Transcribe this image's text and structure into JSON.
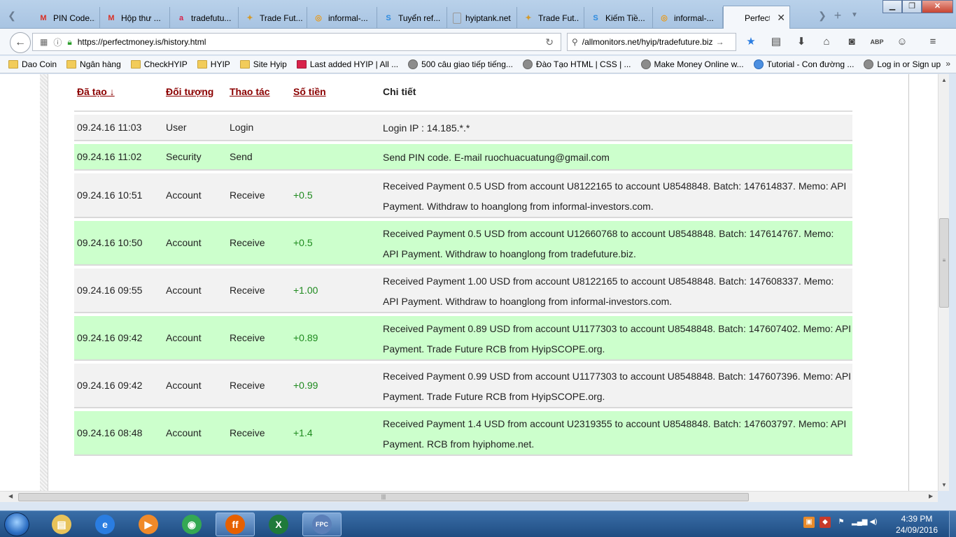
{
  "browser": {
    "tabs": [
      {
        "title": "PIN Code...",
        "icon": "gmail-icon",
        "glyph": "M",
        "color": "#d93025"
      },
      {
        "title": "Hộp thư ...",
        "icon": "gmail-icon",
        "glyph": "M",
        "color": "#d93025"
      },
      {
        "title": "tradefutu...",
        "icon": "a-logo-icon",
        "glyph": "a",
        "color": "#d8224a"
      },
      {
        "title": "Trade Fut...",
        "icon": "trade-future-icon",
        "glyph": "✦",
        "color": "#d49a2a"
      },
      {
        "title": "informal-...",
        "icon": "informal-investors-icon",
        "glyph": "◎",
        "color": "#e89a1a"
      },
      {
        "title": "Tuyển ref...",
        "icon": "skype-icon",
        "glyph": "S",
        "color": "#2a8ae0"
      },
      {
        "title": "hyiptank.net ...",
        "icon": "blank-page-icon",
        "glyph": "",
        "color": "#ffffff"
      },
      {
        "title": "Trade Fut...",
        "icon": "trade-future-icon",
        "glyph": "✦",
        "color": "#d49a2a"
      },
      {
        "title": "Kiếm Tiề...",
        "icon": "skype-icon",
        "glyph": "S",
        "color": "#2a8ae0"
      },
      {
        "title": "informal-...",
        "icon": "informal-investors-icon",
        "glyph": "◎",
        "color": "#e89a1a"
      },
      {
        "title": "Perfect M...",
        "icon": "perfect-money-icon",
        "glyph": "",
        "color": "#f4f7fb"
      }
    ],
    "url": "https://perfectmoney.is/history.html",
    "search_text": "/allmonitors.net/hyip/tradefuture.biz",
    "bookmarks": [
      {
        "label": "Dao Coin",
        "type": "folder"
      },
      {
        "label": "Ngân hàng",
        "type": "folder"
      },
      {
        "label": "CheckHYIP",
        "type": "folder"
      },
      {
        "label": "HYIP",
        "type": "folder"
      },
      {
        "label": "Site Hyip",
        "type": "folder"
      },
      {
        "label": "Last added HYIP | All ...",
        "type": "red"
      },
      {
        "label": "500 câu giao tiếp tiếng...",
        "type": "globe"
      },
      {
        "label": "Đào Tạo HTML | CSS | ...",
        "type": "globe"
      },
      {
        "label": "Make Money Online w...",
        "type": "globe"
      },
      {
        "label": "Tutorial - Con đường ...",
        "type": "skype"
      },
      {
        "label": "Log in or Sign up",
        "type": "globe"
      }
    ],
    "bookmarks_more": "»"
  },
  "table": {
    "headers": {
      "created": "Đã tạo ↓",
      "object": "Đối tượng",
      "action": "Thao tác",
      "amount": "Số tiền",
      "detail": "Chi tiết"
    },
    "rows": [
      {
        "date": "09.24.16 11:03",
        "object": "User",
        "action": "Login",
        "amount": "",
        "detail": "Login IP : 14.185.*.*",
        "style": "grey"
      },
      {
        "date": "09.24.16 11:02",
        "object": "Security",
        "action": "Send",
        "amount": "",
        "detail": "Send PIN code. E-mail ruochuacuatung@gmail.com",
        "style": "green"
      },
      {
        "date": "09.24.16 10:51",
        "object": "Account",
        "action": "Receive",
        "amount": "+0.5",
        "detail": "Received Payment 0.5 USD from account U8122165 to account U8548848. Batch: 147614837. Memo: API Payment. Withdraw to hoanglong from informal-investors.com.",
        "style": "grey"
      },
      {
        "date": "09.24.16 10:50",
        "object": "Account",
        "action": "Receive",
        "amount": "+0.5",
        "detail": "Received Payment 0.5 USD from account U12660768 to account U8548848. Batch: 147614767. Memo: API Payment. Withdraw to hoanglong from tradefuture.biz.",
        "style": "green"
      },
      {
        "date": "09.24.16 09:55",
        "object": "Account",
        "action": "Receive",
        "amount": "+1.00",
        "detail": "Received Payment 1.00 USD from account U8122165 to account U8548848. Batch: 147608337. Memo: API Payment. Withdraw to hoanglong from informal-investors.com.",
        "style": "grey"
      },
      {
        "date": "09.24.16 09:42",
        "object": "Account",
        "action": "Receive",
        "amount": "+0.89",
        "detail": "Received Payment 0.89 USD from account U1177303 to account U8548848. Batch: 147607402. Memo: API Payment. Trade Future RCB from HyipSCOPE.org.",
        "style": "green"
      },
      {
        "date": "09.24.16 09:42",
        "object": "Account",
        "action": "Receive",
        "amount": "+0.99",
        "detail": "Received Payment 0.99 USD from account U1177303 to account U8548848. Batch: 147607396. Memo: API Payment. Trade Future RCB from HyipSCOPE.org.",
        "style": "grey"
      },
      {
        "date": "09.24.16 08:48",
        "object": "Account",
        "action": "Receive",
        "amount": "+1.4",
        "detail": "Received Payment 1.4 USD from account U2319355 to account U8548848. Batch: 147603797. Memo: API Payment. RCB from hyiphome.net.",
        "style": "green"
      }
    ]
  },
  "taskbar": {
    "apps": [
      {
        "name": "explorer",
        "icon": "folder-icon",
        "glyph": "▤",
        "color": "#e8c35a"
      },
      {
        "name": "internet-explorer",
        "icon": "ie-icon",
        "glyph": "e",
        "color": "#2a7de1"
      },
      {
        "name": "media-player",
        "icon": "media-player-icon",
        "glyph": "▶",
        "color": "#f08a2a"
      },
      {
        "name": "chrome",
        "icon": "chrome-icon",
        "glyph": "◉",
        "color": "#34a853"
      },
      {
        "name": "firefox",
        "icon": "firefox-icon",
        "glyph": "ff",
        "color": "#e66000"
      },
      {
        "name": "excel",
        "icon": "excel-icon",
        "glyph": "X",
        "color": "#1f7a3a"
      },
      {
        "name": "fpc",
        "icon": "fpc-icon",
        "glyph": "FPC",
        "color": "#5b7fb8"
      }
    ],
    "time": "4:39 PM",
    "date": "24/09/2016"
  }
}
